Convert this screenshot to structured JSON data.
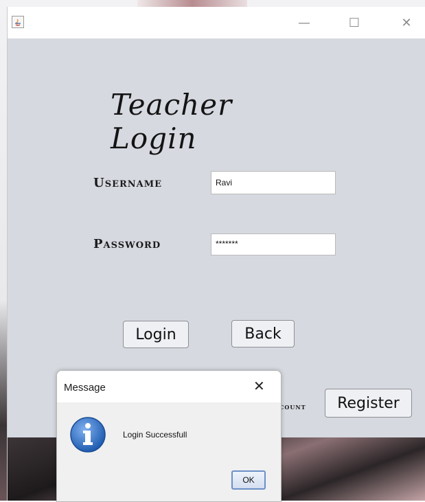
{
  "window": {
    "min_symbol": "—",
    "max_symbol": "☐",
    "close_symbol": "✕"
  },
  "form": {
    "heading": "Teacher Login",
    "username_label": "Username",
    "password_label": "Password",
    "username_value": "Ravi",
    "password_value": "*******",
    "login_button": "Login",
    "back_button": "Back",
    "account_text": "count",
    "register_button": "Register"
  },
  "dialog": {
    "title": "Message",
    "close_symbol": "✕",
    "message": "Login Successfull",
    "ok_button": "OK",
    "icon": "info-icon"
  },
  "colors": {
    "window_bg": "#d6d9e0",
    "dialog_icon_blue": "#2f6fc4"
  }
}
